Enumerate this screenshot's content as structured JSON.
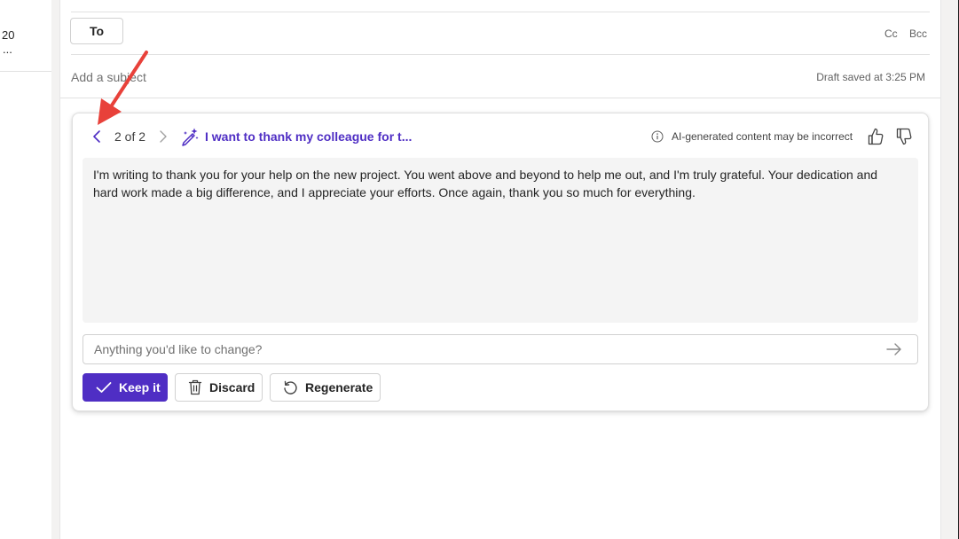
{
  "mail_list": {
    "date_fragment": "20",
    "ellipsis": "..."
  },
  "header": {
    "to_label": "To",
    "cc_label": "Cc",
    "bcc_label": "Bcc",
    "subject_placeholder": "Add a subject",
    "draft_status": "Draft saved at 3:25 PM"
  },
  "copilot": {
    "page_indicator": "2 of 2",
    "prompt": "I want to thank my colleague for t...",
    "disclaimer": "AI-generated content may be incorrect",
    "draft": "I'm writing to thank you for your help on the new project. You went above and beyond to help me out, and I'm truly grateful. Your dedication and hard work made a big difference, and I appreciate your efforts. Once again, thank you so much for everything.",
    "change_placeholder": "Anything you'd like to change?",
    "keep_label": "Keep it",
    "discard_label": "Discard",
    "regenerate_label": "Regenerate"
  },
  "colors": {
    "accent": "#4f2ec4",
    "annotation": "#e8413a"
  },
  "icons": [
    "chevron-left-icon",
    "chevron-right-icon",
    "pen-sparkle-icon",
    "info-icon",
    "thumbs-up-icon",
    "thumbs-down-icon",
    "send-arrow-icon",
    "checkmark-icon",
    "trash-icon",
    "refresh-icon"
  ]
}
